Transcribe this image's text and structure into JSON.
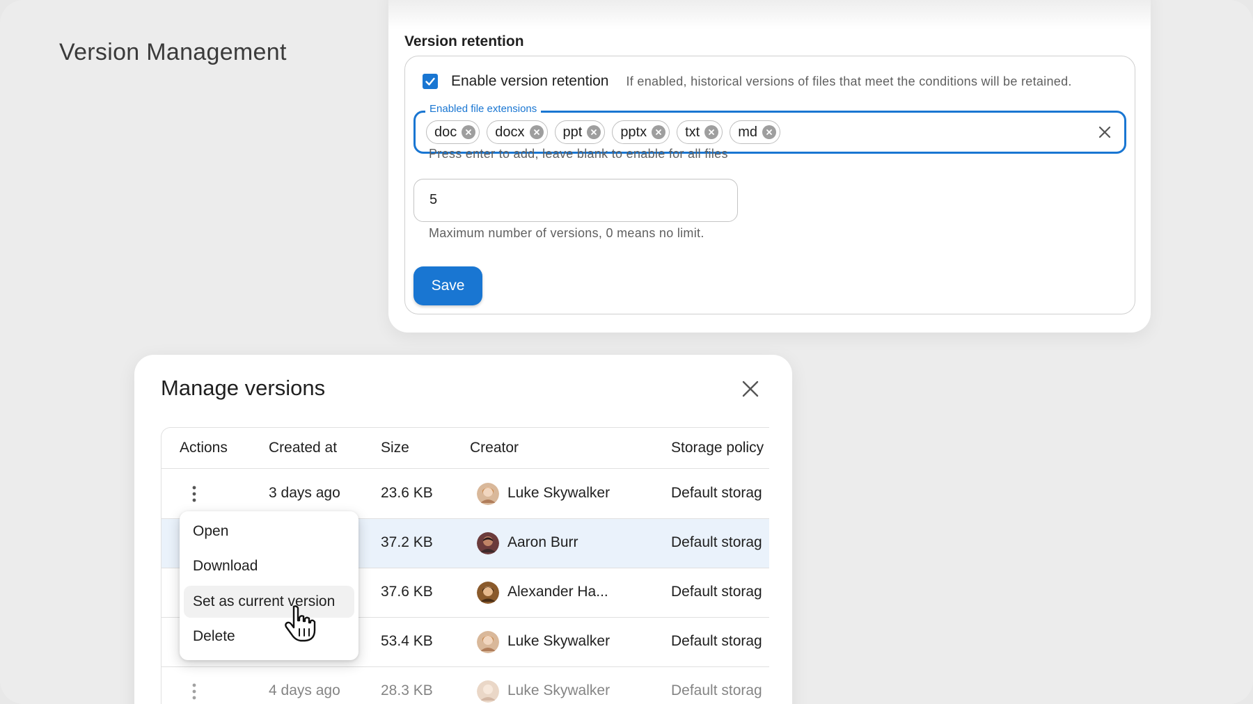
{
  "page": {
    "title": "Version Management"
  },
  "settings": {
    "section_title": "Version retention",
    "enable_checkbox": {
      "label": "Enable version retention",
      "checked": true,
      "hint": "If enabled, historical versions of files that meet the conditions will be retained."
    },
    "extensions_field": {
      "label": "Enabled file extensions",
      "chips": [
        "doc",
        "docx",
        "ppt",
        "pptx",
        "txt",
        "md"
      ],
      "helper": "Press enter to add, leave blank to enable for all files"
    },
    "max_versions": {
      "value": "5",
      "helper": "Maximum number of versions, 0 means no limit."
    },
    "save_label": "Save",
    "accent_color": "#1976d2"
  },
  "dialog": {
    "title": "Manage versions",
    "columns": [
      "Actions",
      "Created at",
      "Size",
      "Creator",
      "Storage policy"
    ],
    "rows": [
      {
        "created": "3 days ago",
        "size": "23.6 KB",
        "creator": "Luke Skywalker",
        "storage": "Default storag"
      },
      {
        "created": "",
        "size": "37.2 KB",
        "creator": "Aaron Burr",
        "storage": "Default storag"
      },
      {
        "created": "",
        "size": "37.6 KB",
        "creator": "Alexander Ha...",
        "storage": "Default storag"
      },
      {
        "created": "",
        "size": "53.4 KB",
        "creator": "Luke Skywalker",
        "storage": "Default storag"
      },
      {
        "created": "4 days ago",
        "size": "28.3 KB",
        "creator": "Luke Skywalker",
        "storage": "Default storag"
      }
    ],
    "context_menu": [
      "Open",
      "Download",
      "Set as current version",
      "Delete"
    ],
    "hovered_menu_item": "Set as current version",
    "highlight_row_color": "#eaf2fb"
  }
}
